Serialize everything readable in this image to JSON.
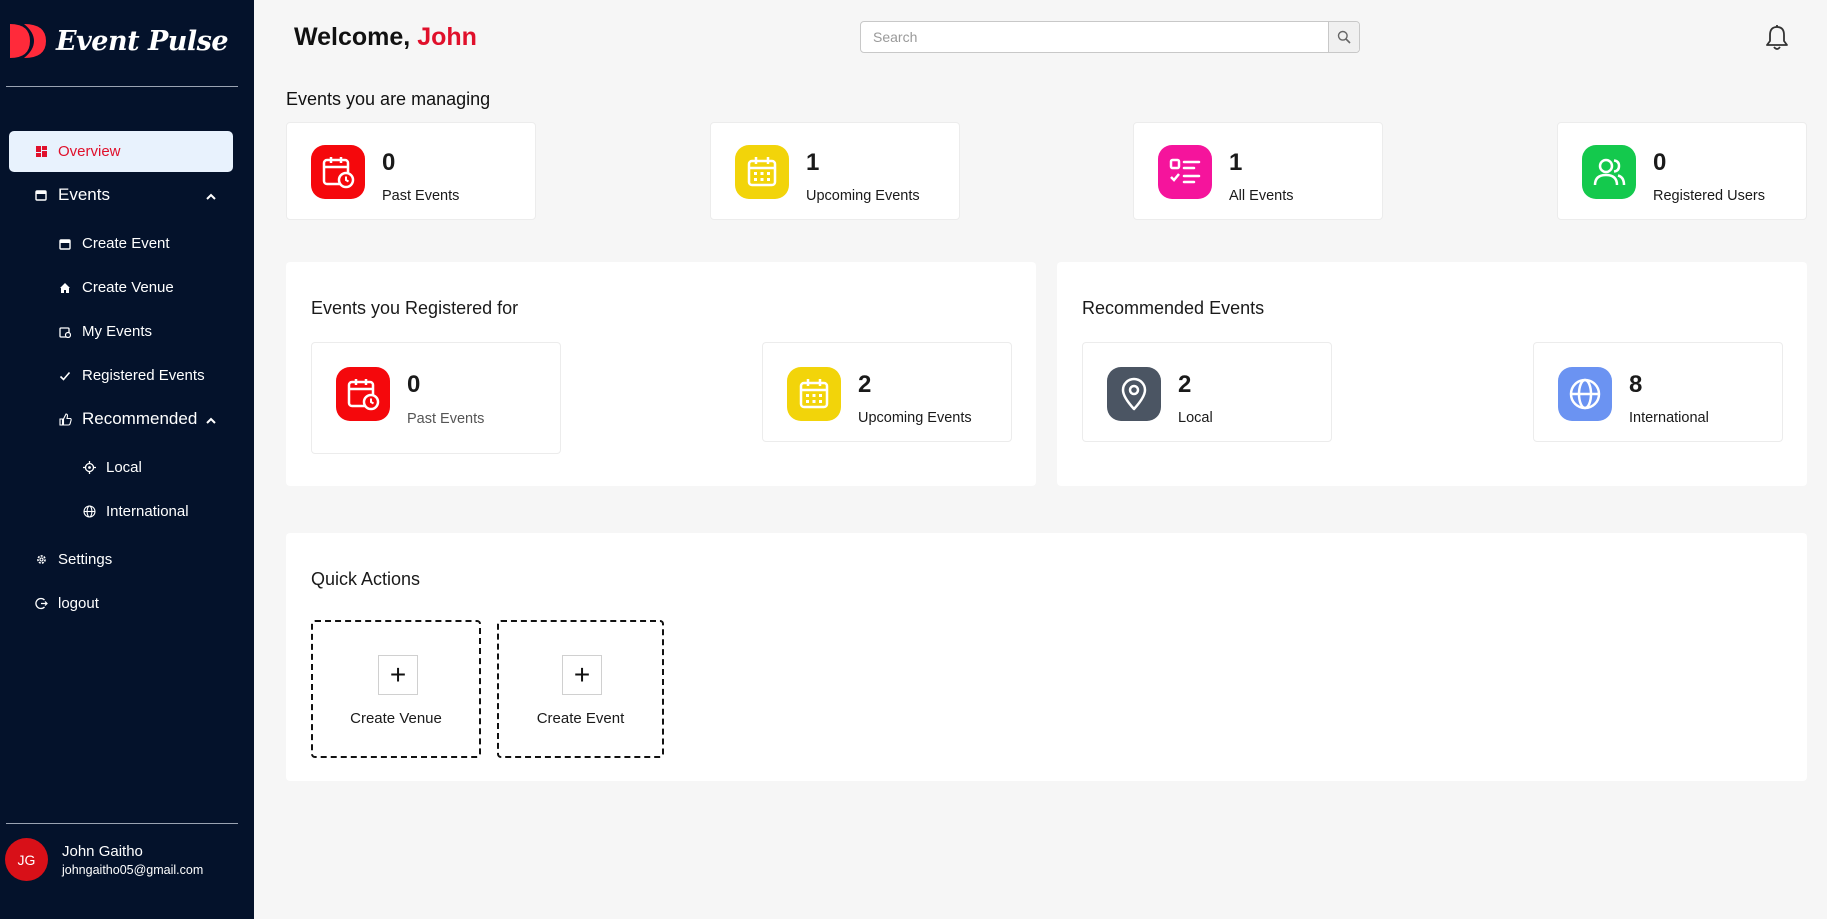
{
  "brand": {
    "name": "Event Pulse",
    "accent": "#e0102b"
  },
  "header": {
    "welcome_prefix": "Welcome,",
    "user_first_name": "John",
    "search_placeholder": "Search"
  },
  "sidebar": {
    "items": [
      {
        "label": "Overview",
        "icon": "grid-icon"
      },
      {
        "label": "Events",
        "icon": "calendar-icon"
      },
      {
        "label": "Create Event",
        "icon": "calendar-icon"
      },
      {
        "label": "Create Venue",
        "icon": "home-icon"
      },
      {
        "label": "My Events",
        "icon": "calendar-clock-icon"
      },
      {
        "label": "Registered Events",
        "icon": "check-icon"
      },
      {
        "label": "Recommended",
        "icon": "thumbs-up-icon"
      },
      {
        "label": "Local",
        "icon": "locate-icon"
      },
      {
        "label": "International",
        "icon": "globe-icon"
      },
      {
        "label": "Settings",
        "icon": "gear-icon"
      },
      {
        "label": "logout",
        "icon": "logout-icon"
      }
    ],
    "user": {
      "initials": "JG",
      "name": "John Gaitho",
      "email": "johngaitho05@gmail.com"
    }
  },
  "managing": {
    "title": "Events you are managing",
    "stats": [
      {
        "value": "0",
        "label": "Past Events",
        "color": "#f5080c",
        "icon": "calendar-clock-icon"
      },
      {
        "value": "1",
        "label": "Upcoming Events",
        "color": "#f2d40a",
        "icon": "calendar-icon"
      },
      {
        "value": "1",
        "label": "All Events",
        "color": "#f5149c",
        "icon": "checklist-icon"
      },
      {
        "value": "0",
        "label": "Registered Users",
        "color": "#14c94d",
        "icon": "users-icon"
      }
    ]
  },
  "registered": {
    "title": "Events you Registered for",
    "stats": [
      {
        "value": "0",
        "label": "Past Events",
        "color": "#f5080c",
        "icon": "calendar-clock-icon"
      },
      {
        "value": "2",
        "label": "Upcoming Events",
        "color": "#f2d40a",
        "icon": "calendar-icon"
      }
    ]
  },
  "recommended": {
    "title": "Recommended Events",
    "stats": [
      {
        "value": "2",
        "label": "Local",
        "color": "#4b5563",
        "icon": "map-pin-icon"
      },
      {
        "value": "8",
        "label": "International",
        "color": "#6b93f2",
        "icon": "globe-icon"
      }
    ]
  },
  "quick_actions": {
    "title": "Quick Actions",
    "items": [
      {
        "label": "Create Venue",
        "symbol": "+"
      },
      {
        "label": "Create Event",
        "symbol": "+"
      }
    ]
  }
}
